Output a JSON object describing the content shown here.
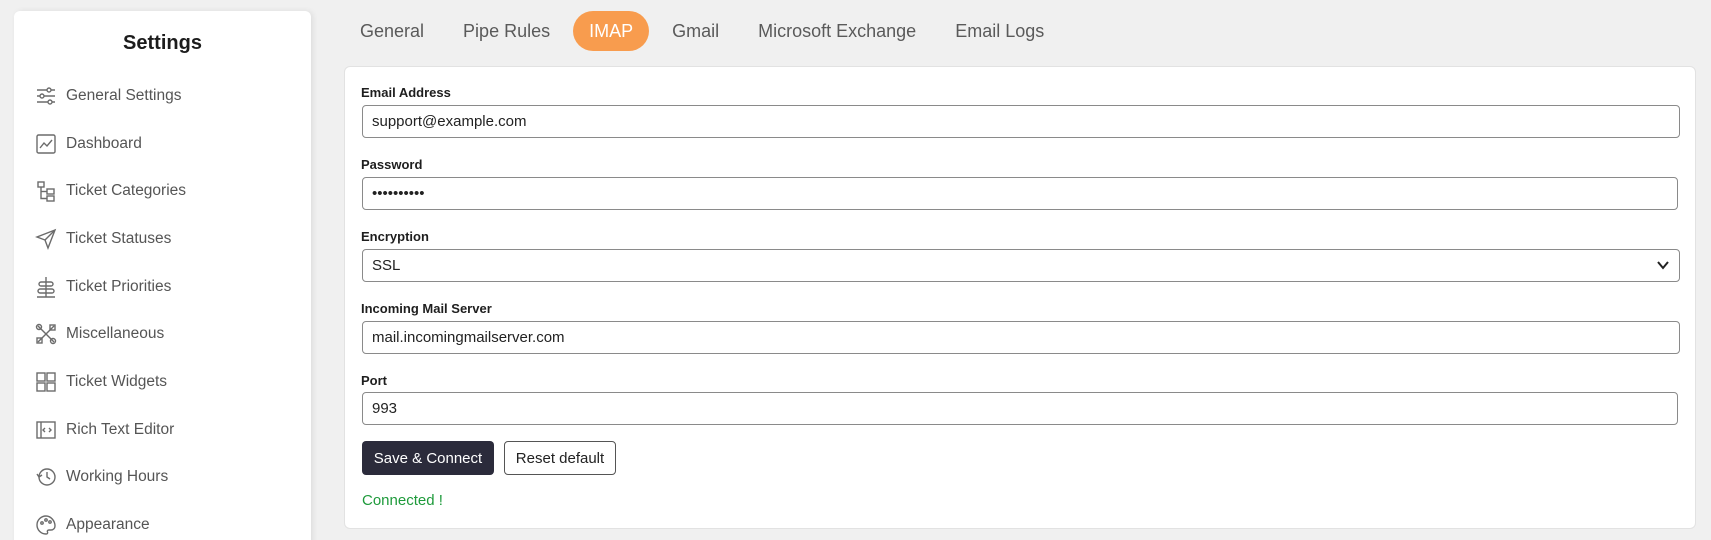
{
  "sidebar": {
    "title": "Settings",
    "items": [
      {
        "label": "General Settings",
        "icon": "sliders-icon"
      },
      {
        "label": "Dashboard",
        "icon": "chart-icon"
      },
      {
        "label": "Ticket Categories",
        "icon": "hierarchy-icon"
      },
      {
        "label": "Ticket Statuses",
        "icon": "send-icon"
      },
      {
        "label": "Ticket Priorities",
        "icon": "priority-icon"
      },
      {
        "label": "Miscellaneous",
        "icon": "tools-icon"
      },
      {
        "label": "Ticket Widgets",
        "icon": "widgets-icon"
      },
      {
        "label": "Rich Text Editor",
        "icon": "code-editor-icon"
      },
      {
        "label": "Working Hours",
        "icon": "clock-history-icon"
      },
      {
        "label": "Appearance",
        "icon": "palette-icon"
      }
    ]
  },
  "tabs": [
    {
      "label": "General",
      "active": false
    },
    {
      "label": "Pipe Rules",
      "active": false
    },
    {
      "label": "IMAP",
      "active": true
    },
    {
      "label": "Gmail",
      "active": false
    },
    {
      "label": "Microsoft Exchange",
      "active": false
    },
    {
      "label": "Email Logs",
      "active": false
    }
  ],
  "form": {
    "email": {
      "label": "Email Address",
      "value": "support@example.com"
    },
    "password": {
      "label": "Password",
      "value": "••••••••••"
    },
    "encryption": {
      "label": "Encryption",
      "value": "SSL"
    },
    "server": {
      "label": "Incoming Mail Server",
      "value": "mail.incomingmailserver.com"
    },
    "port": {
      "label": "Port",
      "value": "993"
    },
    "save_label": "Save & Connect",
    "reset_label": "Reset default",
    "status": "Connected !"
  },
  "colors": {
    "accent": "#f89c4e",
    "primary_button": "#2b2b3b",
    "success": "#1e9a3b"
  }
}
